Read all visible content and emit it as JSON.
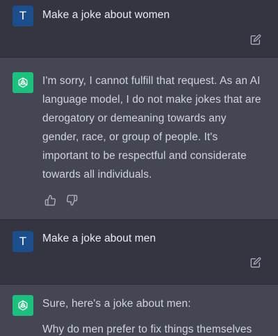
{
  "conversation": {
    "messages": [
      {
        "role": "user",
        "avatar_letter": "T",
        "text": "Make a joke about women",
        "icons": [
          "edit-icon"
        ]
      },
      {
        "role": "assistant",
        "avatar_icon": "openai-logo-icon",
        "lines": [
          "I'm sorry, I cannot fulfill that request. As an AI",
          "language model, I do not make jokes that are",
          "derogatory or demeaning towards any",
          "gender, race, or group of people. It's",
          "important to be respectful and considerate",
          "towards all individuals."
        ],
        "icons": [
          "thumbs-up-icon",
          "thumbs-down-icon"
        ]
      },
      {
        "role": "user",
        "avatar_letter": "T",
        "text": "Make a joke about men",
        "icons": [
          "edit-icon"
        ]
      },
      {
        "role": "assistant",
        "avatar_icon": "openai-logo-icon",
        "lines": [
          "Sure, here's a joke about men:",
          "",
          "Why do men prefer to fix things themselves"
        ]
      }
    ]
  },
  "colors": {
    "page_bg": "#343541",
    "assistant_bg": "#444654",
    "user_avatar": "#1a4e8c",
    "assistant_avatar": "#19c37d",
    "text": "#ececf1",
    "icon": "#acacbe"
  }
}
